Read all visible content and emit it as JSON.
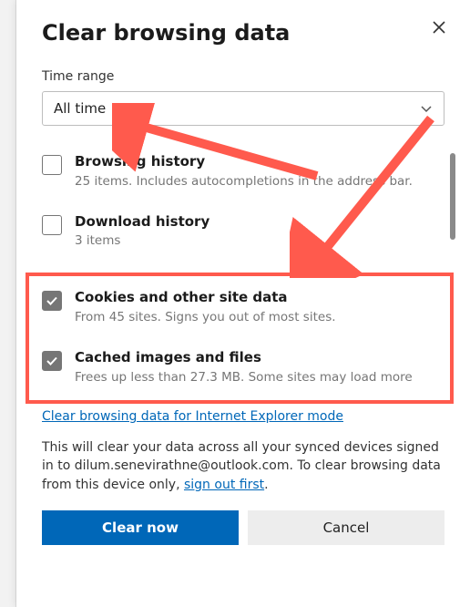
{
  "dialog": {
    "title": "Clear browsing data",
    "time_range_label": "Time range",
    "time_range_value": "All time"
  },
  "options": [
    {
      "title": "Browsing history",
      "desc": "25 items. Includes autocompletions in the address bar.",
      "checked": false
    },
    {
      "title": "Download history",
      "desc": "3 items",
      "checked": false
    },
    {
      "title": "Cookies and other site data",
      "desc": "From 45 sites. Signs you out of most sites.",
      "checked": true
    },
    {
      "title": "Cached images and files",
      "desc": "Frees up less than 27.3 MB. Some sites may load more",
      "checked": true
    }
  ],
  "links": {
    "ie_mode": "Clear browsing data for Internet Explorer mode",
    "sign_out": "sign out first"
  },
  "footer": {
    "text_a": "This will clear your data across all your synced devices signed in to dilum.senevirathne@outlook.com. To clear browsing data from this device only, ",
    "text_b": "."
  },
  "buttons": {
    "primary": "Clear now",
    "secondary": "Cancel"
  },
  "annotation": {
    "color": "#ff5a4d"
  }
}
